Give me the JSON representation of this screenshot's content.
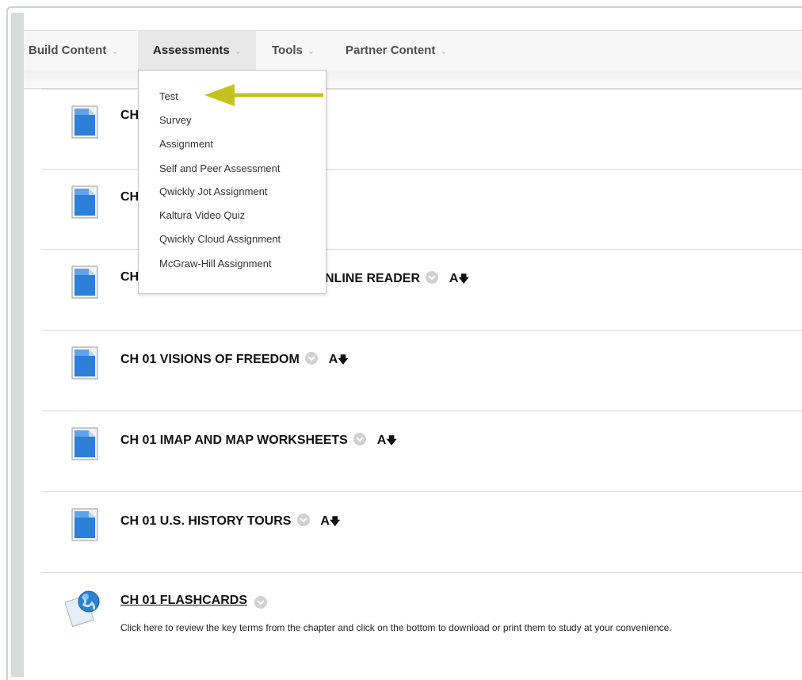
{
  "menubar": {
    "items": [
      {
        "label": "Build Content"
      },
      {
        "label": "Assessments"
      },
      {
        "label": "Tools"
      },
      {
        "label": "Partner Content"
      }
    ]
  },
  "assessments_menu": {
    "items": [
      {
        "label": "Test"
      },
      {
        "label": "Survey"
      },
      {
        "label": "Assignment"
      },
      {
        "label": "Self and Peer Assessment"
      },
      {
        "label": "Qwickly Jot Assignment"
      },
      {
        "label": "Kaltura Video Quiz"
      },
      {
        "label": "Qwickly Cloud Assignment"
      },
      {
        "label": "McGraw-Hill Assignment"
      }
    ]
  },
  "content": {
    "items": [
      {
        "title": "CH",
        "icon": "document-icon"
      },
      {
        "title": "CH",
        "icon": "document-icon"
      },
      {
        "title": "CH",
        "title_tail": "NLINE READER",
        "icon": "document-icon"
      },
      {
        "title": "CH 01 VISIONS OF FREEDOM",
        "icon": "document-icon"
      },
      {
        "title": "CH 01 IMAP AND MAP WORKSHEETS",
        "icon": "document-icon"
      },
      {
        "title": "CH 01 U.S. HISTORY TOURS",
        "icon": "document-icon"
      },
      {
        "title": "CH 01 FLASHCARDS",
        "icon": "web-link-icon",
        "description": "Click here to review the key terms from the chapter and click on the bottom to download or print them to study at your convenience."
      }
    ]
  },
  "colors": {
    "accent_arrow": "#c5c21e",
    "doc_blue": "#2e7fd9"
  }
}
